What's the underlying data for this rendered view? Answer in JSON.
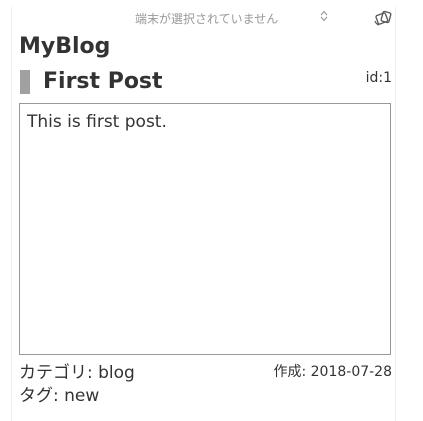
{
  "toolbar": {
    "device_select_value": "端末が選択されていません",
    "device_icon": "device-rotate-icon"
  },
  "blog": {
    "title": "MyBlog"
  },
  "post": {
    "title": "First Post",
    "id_text": "id:1",
    "body": "This is first post.",
    "category_text": "カテゴリ: blog",
    "tag_text": "タグ: new",
    "created_text": "作成: 2018-07-28"
  },
  "colors": {
    "marker": "#a0a0a0",
    "text": "#333333",
    "muted": "#999999",
    "border": "#999999"
  }
}
